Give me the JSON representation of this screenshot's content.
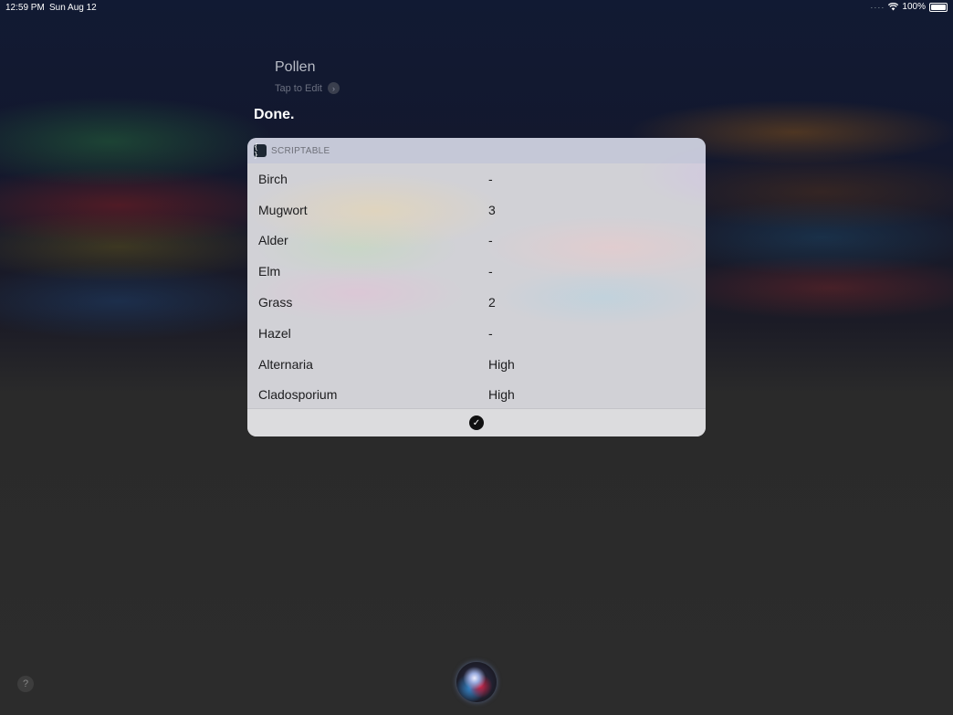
{
  "status_bar": {
    "time": "12:59 PM",
    "date": "Sun Aug 12",
    "battery": "100%"
  },
  "shortcut": {
    "title": "Pollen",
    "edit_hint": "Tap to Edit",
    "result": "Done."
  },
  "card": {
    "app_name": "SCRIPTABLE",
    "app_icon_glyph": "{ }",
    "rows": [
      {
        "name": "Birch",
        "value": "-"
      },
      {
        "name": "Mugwort",
        "value": "3"
      },
      {
        "name": "Alder",
        "value": "-"
      },
      {
        "name": "Elm",
        "value": "-"
      },
      {
        "name": "Grass",
        "value": "2"
      },
      {
        "name": "Hazel",
        "value": "-"
      },
      {
        "name": "Alternaria",
        "value": "High"
      },
      {
        "name": "Cladosporium",
        "value": "High"
      }
    ]
  },
  "help_label": "?"
}
